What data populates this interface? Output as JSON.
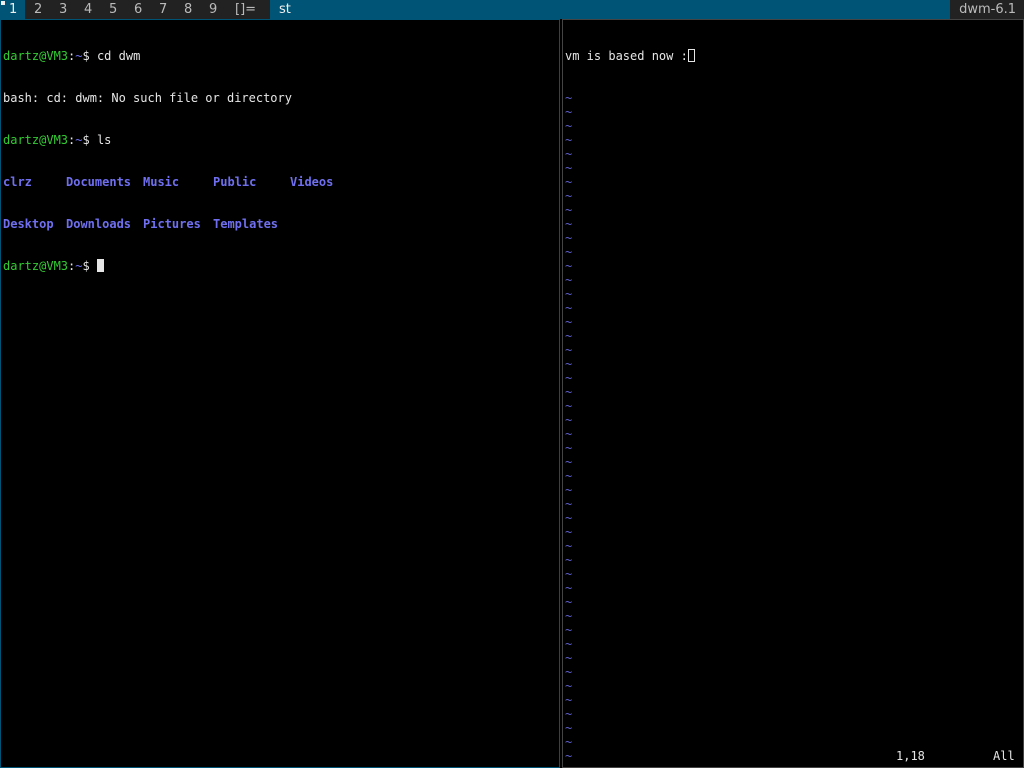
{
  "bar": {
    "tags": [
      {
        "label": "1",
        "selected": true,
        "occupied": true
      },
      {
        "label": "2",
        "selected": false,
        "occupied": false
      },
      {
        "label": "3",
        "selected": false,
        "occupied": false
      },
      {
        "label": "4",
        "selected": false,
        "occupied": false
      },
      {
        "label": "5",
        "selected": false,
        "occupied": false
      },
      {
        "label": "6",
        "selected": false,
        "occupied": false
      },
      {
        "label": "7",
        "selected": false,
        "occupied": false
      },
      {
        "label": "8",
        "selected": false,
        "occupied": false
      },
      {
        "label": "9",
        "selected": false,
        "occupied": false
      }
    ],
    "layout_symbol": "[]=",
    "window_title": "st",
    "status": "dwm-6.1"
  },
  "terminal": {
    "prompt_user": "dartz@VM3",
    "prompt_sep": ":",
    "prompt_path": "~",
    "prompt_symbol": "$ ",
    "cmd1": "cd dwm",
    "error_line": "bash: cd: dwm: No such file or directory",
    "cmd2": "ls",
    "ls_row1": [
      "clrz",
      "Documents",
      "Music",
      "Public",
      "Videos"
    ],
    "ls_row2": [
      "Desktop",
      "Downloads",
      "Pictures",
      "Templates"
    ]
  },
  "vim": {
    "text": "vm is based now :",
    "cursor_char": "",
    "tilde": "~",
    "tilde_count": 51,
    "ruler_position": "1,18",
    "ruler_scroll": "All"
  },
  "colors": {
    "accent": "#005577",
    "bar_bg": "#222222",
    "prompt_user": "#33cc33",
    "directory": "#6f6ff0",
    "tilde": "#5f5fcf"
  }
}
